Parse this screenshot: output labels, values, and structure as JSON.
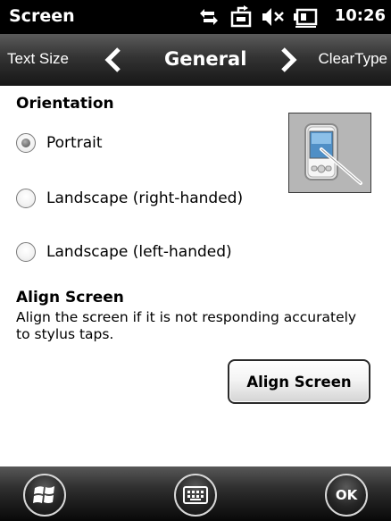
{
  "statusbar": {
    "app_title": "Screen",
    "time": "10:26",
    "icons": [
      "connectivity-icon",
      "sync-icon",
      "speaker-mute-icon",
      "battery-icon"
    ]
  },
  "tabs": {
    "previous": "Text Size",
    "current": "General",
    "next": "ClearType"
  },
  "orientation": {
    "heading": "Orientation",
    "options": [
      {
        "label": "Portrait",
        "checked": true
      },
      {
        "label": "Landscape (right-handed)",
        "checked": false
      },
      {
        "label": "Landscape (left-handed)",
        "checked": false
      }
    ],
    "preview_icon": "pda-stylus-icon"
  },
  "align": {
    "heading": "Align Screen",
    "description": "Align the screen if it is not responding accurately to stylus taps.",
    "button_label": "Align Screen"
  },
  "softkeys": {
    "start_icon": "windows-start-icon",
    "keyboard_icon": "keyboard-icon",
    "ok_label": "OK"
  }
}
